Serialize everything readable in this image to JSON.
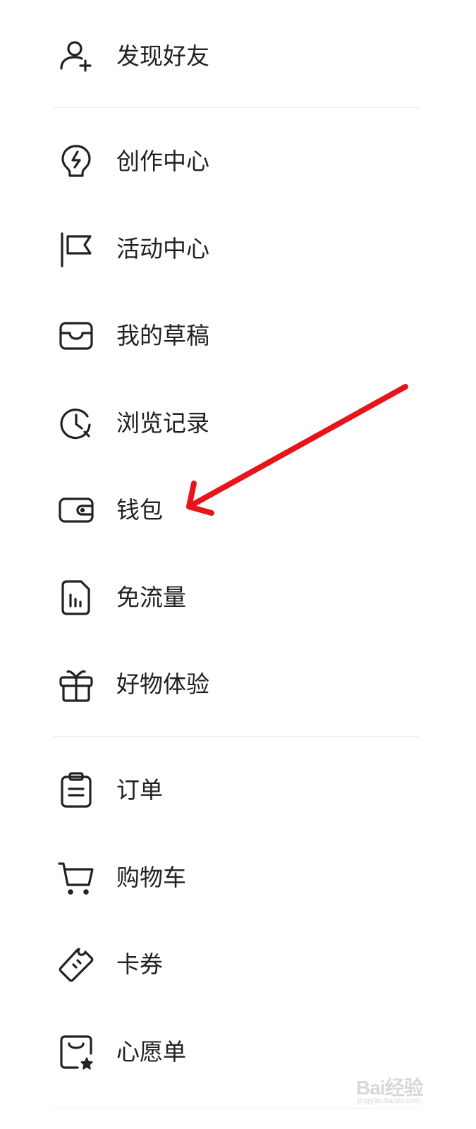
{
  "menu": {
    "friends": {
      "label": "发现好友",
      "icon": "add-friend-icon"
    },
    "creator": {
      "label": "创作中心",
      "icon": "lightbulb-icon"
    },
    "events": {
      "label": "活动中心",
      "icon": "flag-icon"
    },
    "drafts": {
      "label": "我的草稿",
      "icon": "inbox-icon"
    },
    "history": {
      "label": "浏览记录",
      "icon": "history-clock-icon"
    },
    "wallet": {
      "label": "钱包",
      "icon": "wallet-icon"
    },
    "free_data": {
      "label": "免流量",
      "icon": "sim-card-icon"
    },
    "product_trial": {
      "label": "好物体验",
      "icon": "gift-icon"
    },
    "orders": {
      "label": "订单",
      "icon": "clipboard-icon"
    },
    "cart": {
      "label": "购物车",
      "icon": "cart-icon"
    },
    "coupons": {
      "label": "卡券",
      "icon": "ticket-icon"
    },
    "wishlist": {
      "label": "心愿单",
      "icon": "wishlist-bag-icon"
    }
  },
  "annotation": {
    "color": "#e8141b",
    "points_to": "钱包"
  },
  "watermark": {
    "brand": "Bai经验",
    "site": "jingyan.baidu.com"
  },
  "colors": {
    "icon": "#222222",
    "text": "#222222",
    "divider": "#ececec"
  }
}
